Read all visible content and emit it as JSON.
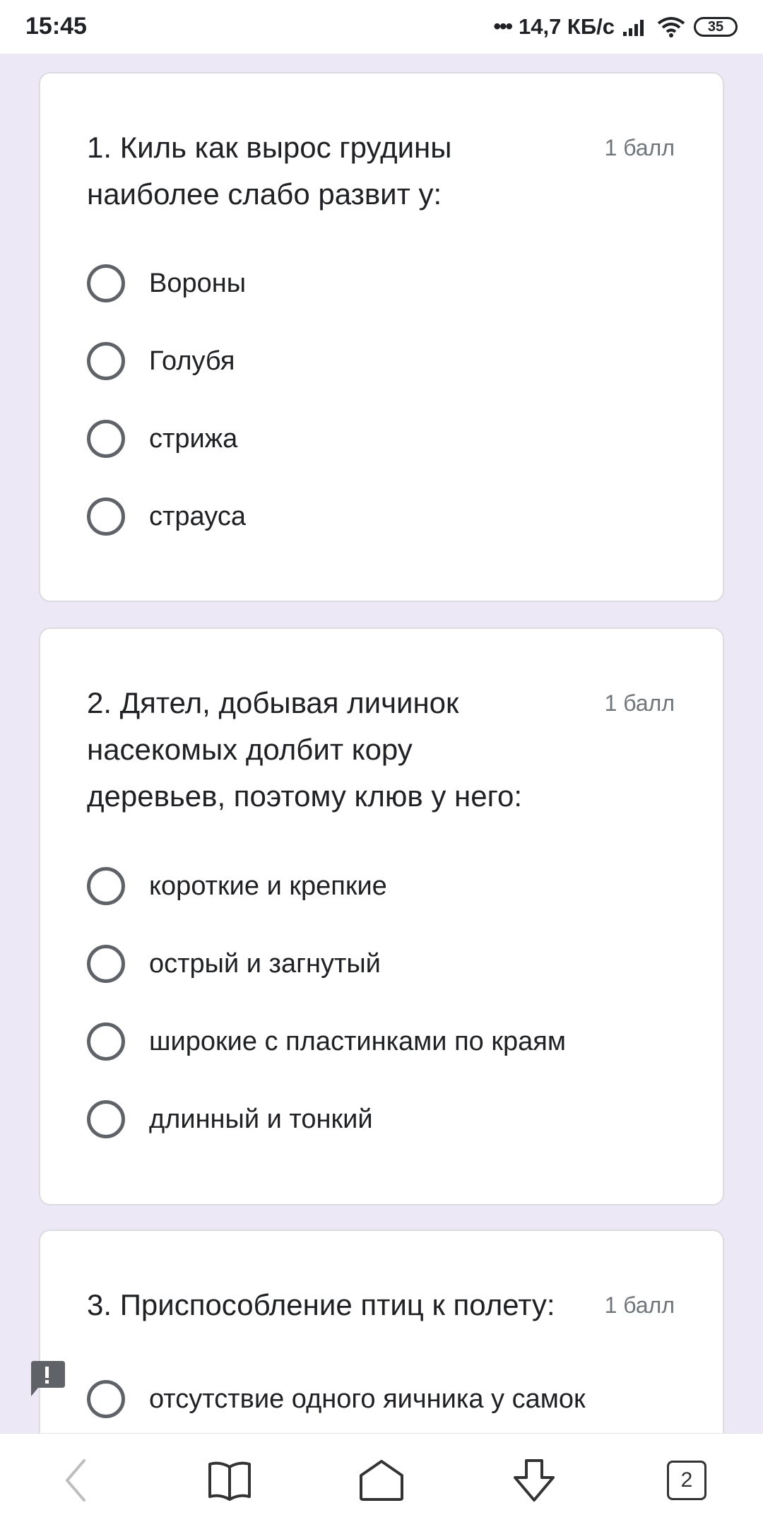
{
  "status_bar": {
    "time": "15:45",
    "dots": "•••",
    "net_speed": "14,7 КБ/с",
    "battery": "35"
  },
  "questions": [
    {
      "title": "1. Киль как вырос грудины наиболее слабо развит у:",
      "points": "1 балл",
      "options": [
        "Вороны",
        "Голубя",
        "стрижа",
        "страуса"
      ]
    },
    {
      "title": "2. Дятел, добывая личинок насекомых долбит кору деревьев, поэтому клюв у него:",
      "points": "1 балл",
      "options": [
        "короткие и крепкие",
        "острый и загнутый",
        "широкие с пластинками по краям",
        "длинный и тонкий"
      ]
    },
    {
      "title": "3. Приспособление птиц к полету:",
      "points": "1 балл",
      "options": [
        "отсутствие одного яичника у самок"
      ]
    }
  ],
  "bottom_nav": {
    "back_icon": "chevron-left-icon",
    "bookmarks_icon": "book-icon",
    "home_icon": "home-icon",
    "download_icon": "arrow-down-icon",
    "tabs_count": "2"
  },
  "colors": {
    "background": "#ede8f6",
    "card": "#ffffff",
    "radio": "#5f6368",
    "points": "#70757a"
  }
}
